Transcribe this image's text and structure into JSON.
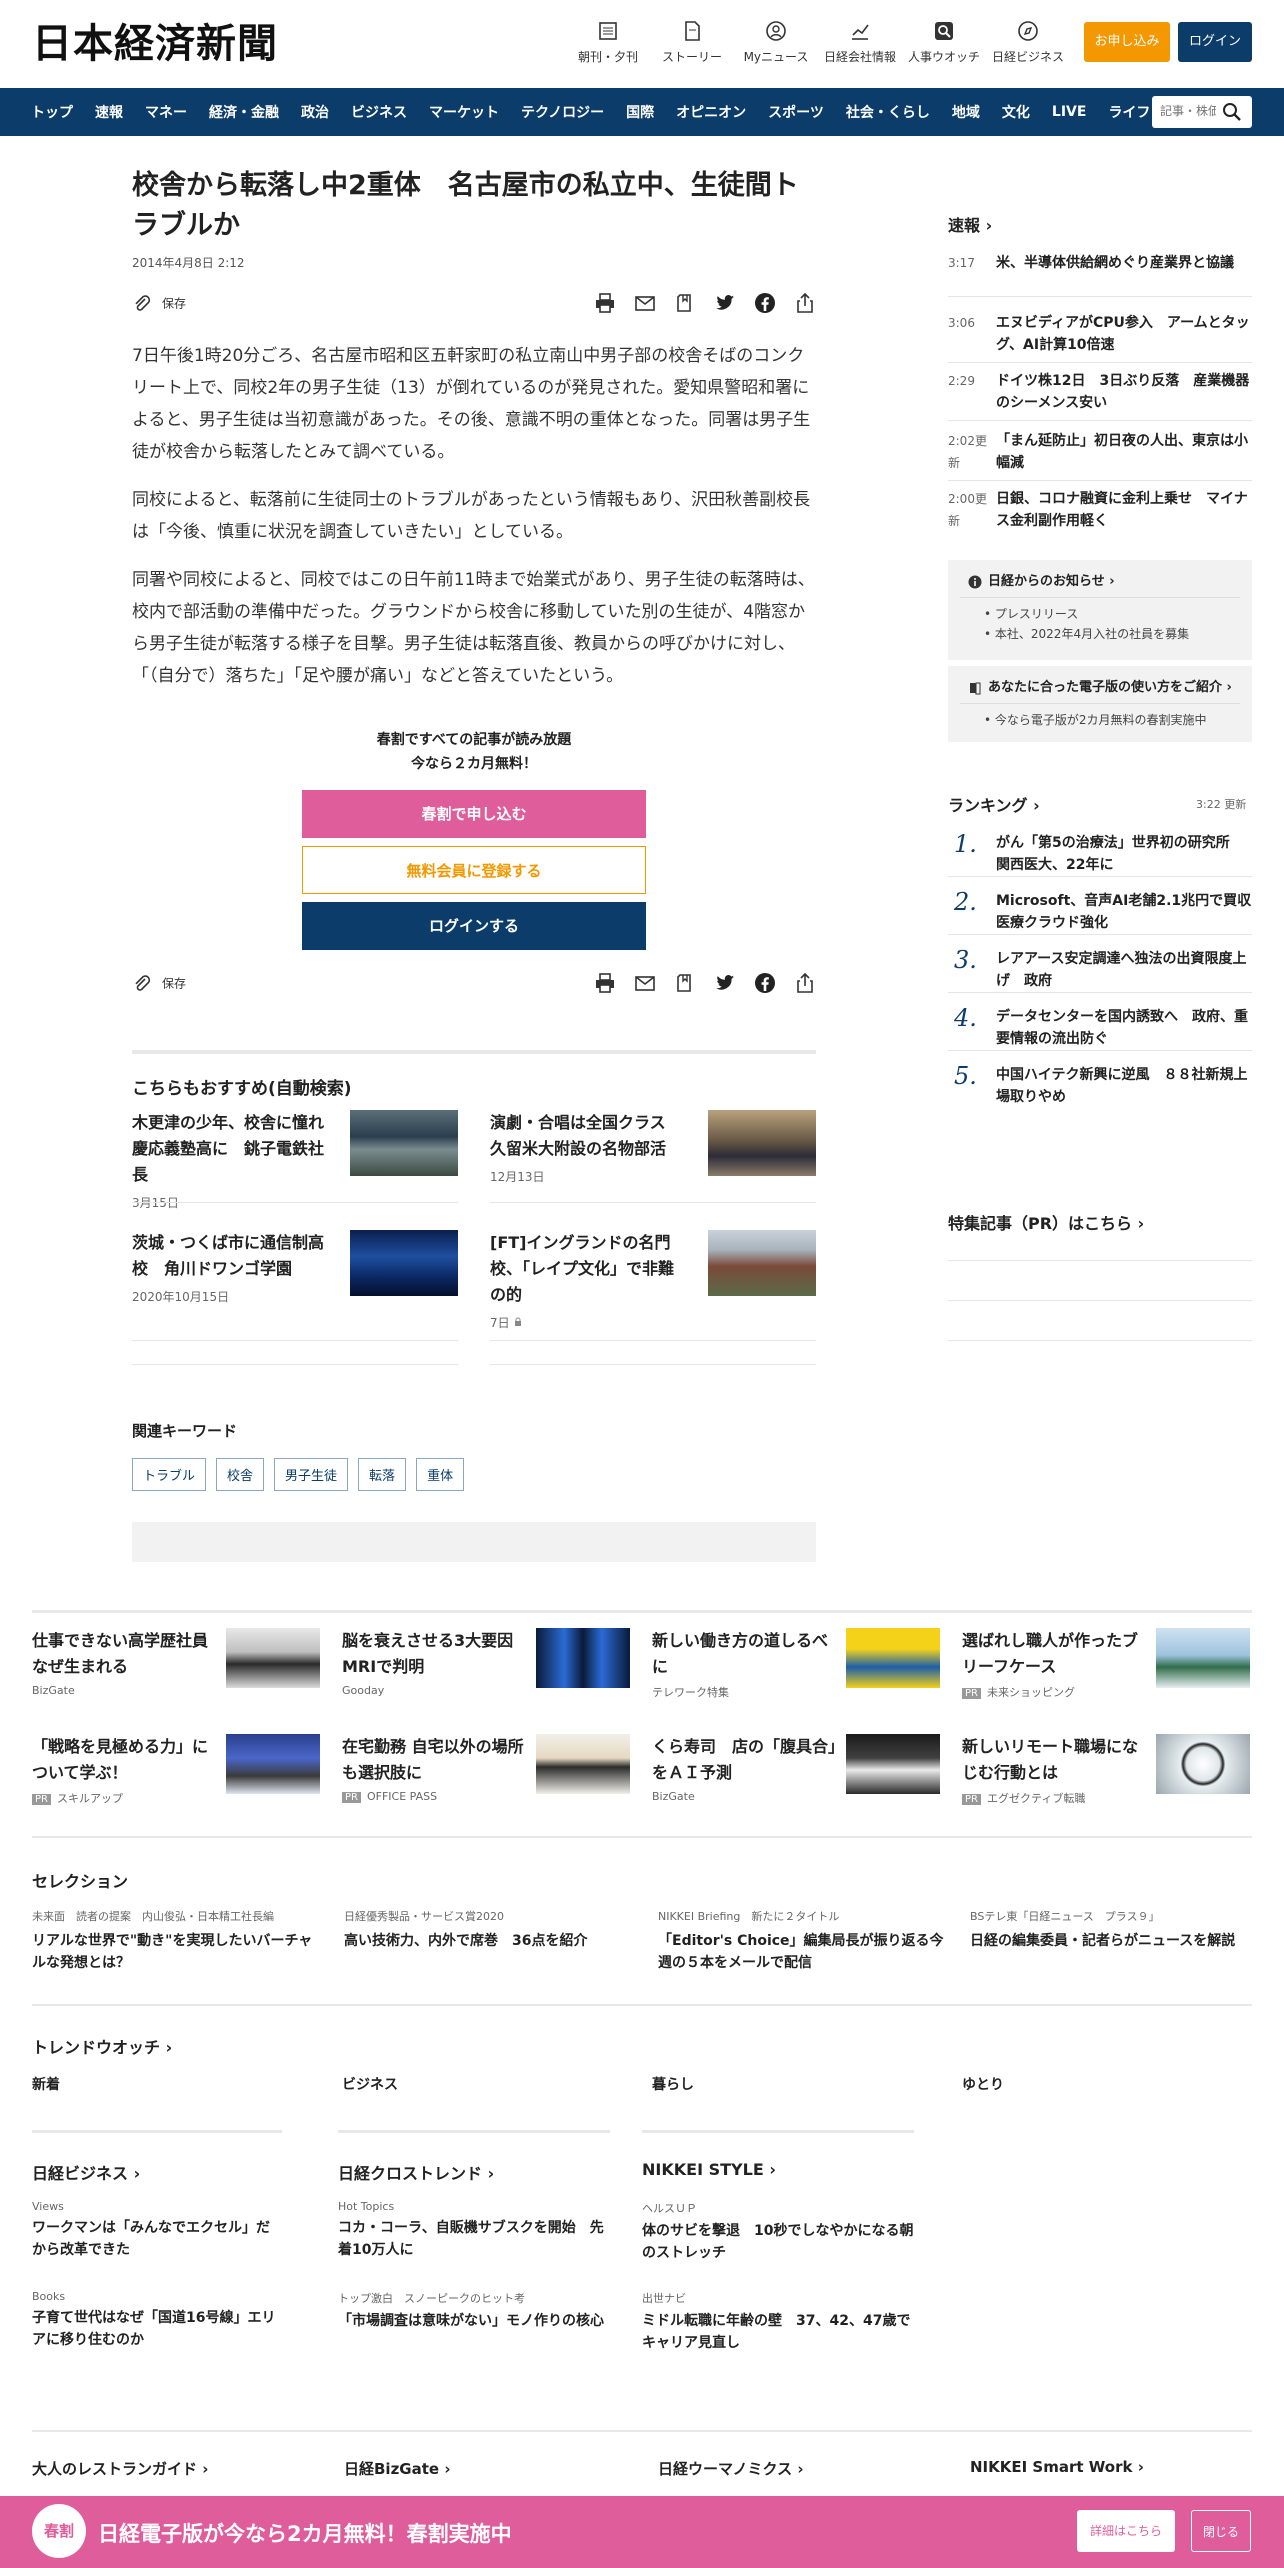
{
  "header": {
    "logo": "日本経済新聞",
    "icons": [
      {
        "label": "朝刊・夕刊",
        "icon": "newspaper-icon"
      },
      {
        "label": "ストーリー",
        "icon": "document-icon"
      },
      {
        "label": "Myニュース",
        "icon": "user-icon"
      },
      {
        "label": "日経会社情報",
        "icon": "chart-icon"
      },
      {
        "label": "人事ウオッチ",
        "icon": "search-icon"
      },
      {
        "label": "日経ビジネス",
        "icon": "compass-icon"
      }
    ],
    "subscribe": "お申し込み",
    "login": "ログイン"
  },
  "nav": {
    "items": [
      "トップ",
      "速報",
      "マネー",
      "経済・金融",
      "政治",
      "ビジネス",
      "マーケット",
      "テクノロジー",
      "国際",
      "オピニオン",
      "スポーツ",
      "社会・くらし",
      "地域",
      "文化",
      "LIVE",
      "ライフ"
    ],
    "search_placeholder": "記事・株価"
  },
  "article": {
    "title": "校舎から転落し中2重体　名古屋市の私立中、生徒間トラブルか",
    "date": "2014年4月8日 2:12",
    "save": "保存",
    "paragraphs": [
      "7日午後1時20分ごろ、名古屋市昭和区五軒家町の私立南山中男子部の校舎そばのコンクリート上で、同校2年の男子生徒（13）が倒れているのが発見された。愛知県警昭和署によると、男子生徒は当初意識があった。その後、意識不明の重体となった。同署は男子生徒が校舎から転落したとみて調べている。",
      "同校によると、転落前に生徒同士のトラブルがあったという情報もあり、沢田秋善副校長は「今後、慎重に状況を調査していきたい」としている。",
      "同署や同校によると、同校ではこの日午前11時まで始業式があり、男子生徒の転落時は、校内で部活動の準備中だった。グラウンドから校舎に移動していた別の生徒が、4階窓から男子生徒が転落する様子を目撃。男子生徒は転落直後、教員からの呼びかけに対し、「（自分で）落ちた」「足や腰が痛い」などと答えていたという。"
    ],
    "promo_line1": "春割ですべての記事が読み放題",
    "promo_line2": "今なら２カ月無料！",
    "promo_btn1": "春割で申し込む",
    "promo_btn2": "無料会員に登録する",
    "promo_btn3": "ログインする"
  },
  "recommend": {
    "title": "こちらもおすすめ(自動検索)",
    "items": [
      {
        "title": "木更津の少年、校舎に憧れ慶応義塾高に　銚子電鉄社長",
        "date": "3月15日"
      },
      {
        "title": "演劇・合唱は全国クラス　久留米大附設の名物部活",
        "date": "12月13日"
      },
      {
        "title": "茨城・つくば市に通信制高校　角川ドワンゴ学園",
        "date": "2020年10月15日"
      },
      {
        "title": "[FT]イングランドの名門校、「レイプ文化」で非難の的",
        "date": "7日"
      }
    ]
  },
  "keywords": {
    "title": "関連キーワード",
    "items": [
      "トラブル",
      "校舎",
      "男子生徒",
      "転落",
      "重体"
    ]
  },
  "sidebar": {
    "breaking_title": "速報",
    "breaking": [
      {
        "time": "3:17",
        "text": "米、半導体供給網めぐり産業界と協議"
      },
      {
        "time": "3:06",
        "text": "エヌビディアがCPU参入　アームとタッグ、AI計算10倍速"
      },
      {
        "time": "2:29",
        "text": "ドイツ株12日　3日ぶり反落　産業機器のシーメンス安い"
      },
      {
        "time": "2:02更新",
        "text": "「まん延防止」初日夜の人出、東京は小幅減"
      },
      {
        "time": "2:00更新",
        "text": "日銀、コロナ融資に金利上乗せ　マイナス金利副作用軽く"
      }
    ],
    "notice1_title": "日経からのお知らせ",
    "notice1_items": [
      "プレスリリース",
      "本社、2022年4月入社の社員を募集"
    ],
    "notice2_title": "あなたに合った電子版の使い方をご紹介",
    "notice2_items": [
      "今なら電子版が2カ月無料の春割実施中"
    ],
    "ranking_title": "ランキング",
    "ranking_updated": "3:22  更新",
    "ranking": [
      {
        "n": "1.",
        "text": "がん「第5の治療法」世界初の研究所　関西医大、22年に"
      },
      {
        "n": "2.",
        "text": "Microsoft、音声AI老舗2.1兆円で買収　医療クラウド強化"
      },
      {
        "n": "3.",
        "text": "レアアース安定調達へ独法の出資限度上げ　政府"
      },
      {
        "n": "4.",
        "text": "データセンターを国内誘致へ　政府、重要情報の流出防ぐ"
      },
      {
        "n": "5.",
        "text": "中国ハイテク新興に逆風　８８社新規上場取りやめ"
      }
    ],
    "feature_title": "特集記事（PR）はこちら"
  },
  "ads": [
    {
      "title": "仕事できない高学歴社員なぜ生まれる",
      "src": "BizGate",
      "pr": false
    },
    {
      "title": "脳を衰えさせる3大要因　MRIで判明",
      "src": "Gooday",
      "pr": false
    },
    {
      "title": "新しい働き方の道しるべに",
      "src": "テレワーク特集",
      "pr": false
    },
    {
      "title": "選ばれし職人が作ったブリーフケース",
      "src": "未来ショッピング",
      "pr": true
    },
    {
      "title": "「戦略を見極める力」について学ぶ！",
      "src": "スキルアップ",
      "pr": true
    },
    {
      "title": "在宅勤務 自宅以外の場所も選択肢に",
      "src": "OFFICE PASS",
      "pr": true
    },
    {
      "title": "くら寿司　店の「腹具合」をＡＩ予測",
      "src": "BizGate",
      "pr": false
    },
    {
      "title": "新しいリモート職場になじむ行動とは",
      "src": "エグゼクティブ転職",
      "pr": true
    }
  ],
  "pr_label": "PR",
  "selection": {
    "title": "セレクション",
    "items": [
      {
        "k": "未来面　読者の提案　内山俊弘・日本精工社長編",
        "t": "リアルな世界で\"動き\"を実現したいバーチャルな発想とは？"
      },
      {
        "k": "日経優秀製品・サービス賞2020",
        "t": "高い技術力、内外で席巻　36点を紹介"
      },
      {
        "k": "NIKKEI Briefing　新たに２タイトル",
        "t": "「Editor's Choice」編集局長が振り返る今週の５本をメールで配信"
      },
      {
        "k": "BSテレ東「日経ニュース　プラス９」",
        "t": "日経の編集委員・記者らがニュースを解説"
      }
    ]
  },
  "trend": {
    "title": "トレンドウオッチ",
    "tabs": [
      "新着",
      "ビジネス",
      "暮らし",
      "ゆとり"
    ]
  },
  "media": [
    {
      "title": "日経ビジネス",
      "items": [
        {
          "k": "Views",
          "t": "ワークマンは「みんなでエクセル」だから改革できた"
        },
        {
          "k": "Books",
          "t": "子育て世代はなぜ「国道16号線」エリアに移り住むのか"
        }
      ]
    },
    {
      "title": "日経クロストレンド",
      "items": [
        {
          "k": "Hot Topics",
          "t": "コカ・コーラ、自販機サブスクを開始　先着10万人に"
        },
        {
          "k": "トップ激白　スノーピークのヒット考",
          "t": "「市場調査は意味がない」モノ作りの核心"
        }
      ]
    },
    {
      "title": "NIKKEI STYLE",
      "items": [
        {
          "k": "ヘルスＵＰ",
          "t": "体のサビを撃退　10秒でしなやかになる朝のストレッチ"
        },
        {
          "k": "出世ナビ",
          "t": "ミドル転職に年齢の壁　37、42、47歳でキャリア見直し"
        }
      ]
    }
  ],
  "footer_links": [
    "大人のレストランガイド",
    "日経BizGate",
    "日経ウーマノミクス",
    "NIKKEI Smart Work"
  ],
  "banner": {
    "badge": "春割",
    "text": "日経電子版が今なら2カ月無料！春割実施中",
    "btn1": "詳細はこちら",
    "btn2": "閉じる"
  }
}
